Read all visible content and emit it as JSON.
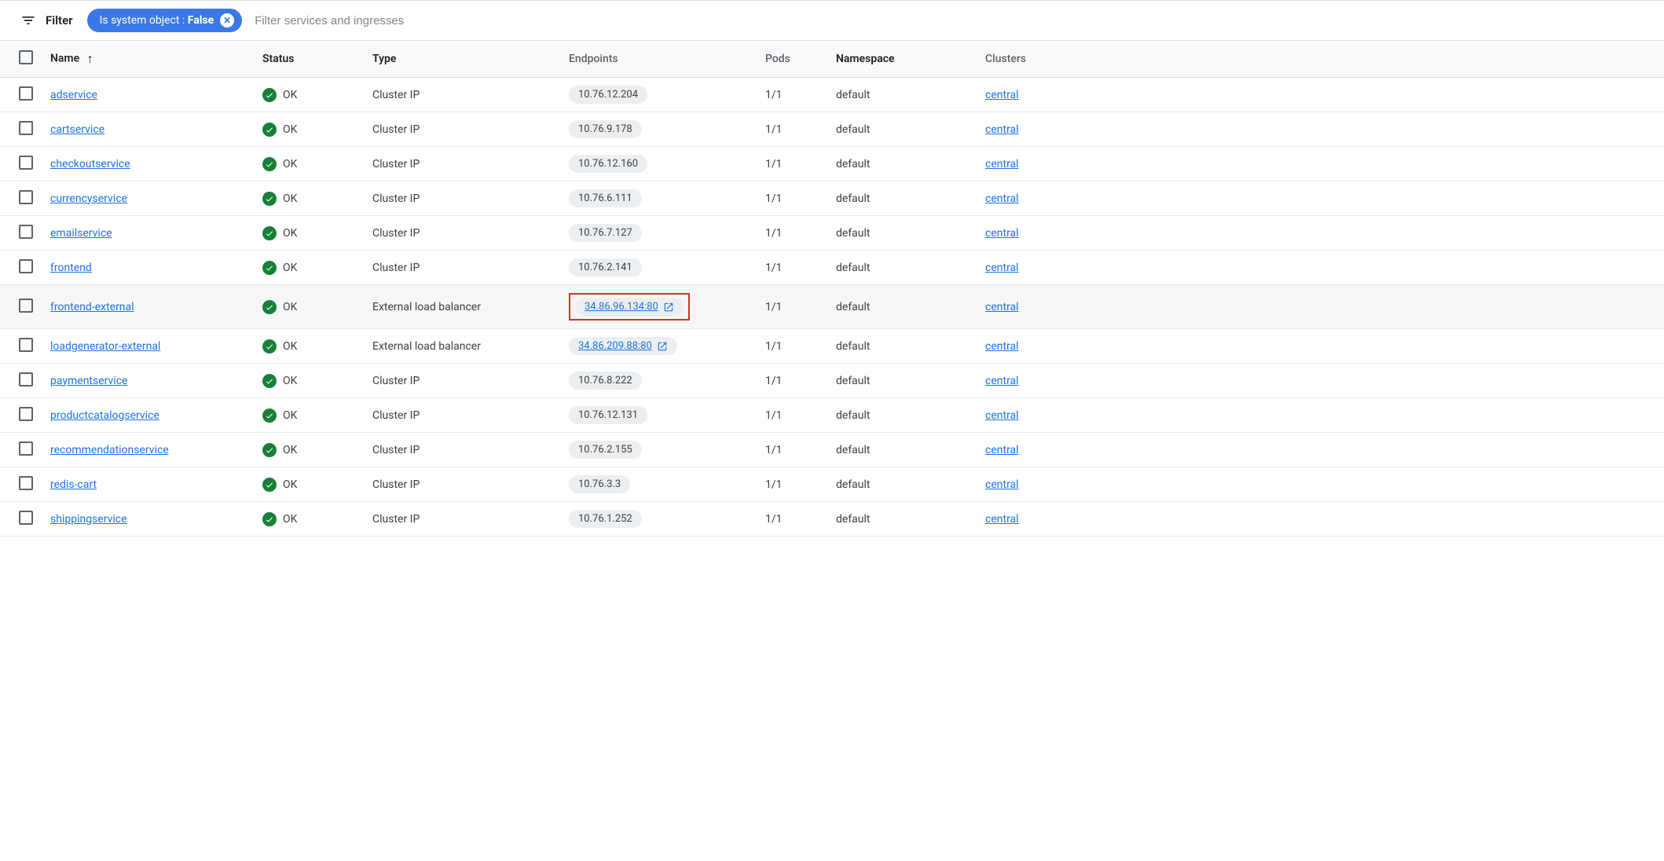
{
  "filter": {
    "label": "Filter",
    "chip_key": "Is system object",
    "chip_sep": " : ",
    "chip_value": "False",
    "placeholder": "Filter services and ingresses"
  },
  "columns": {
    "name": "Name",
    "status": "Status",
    "type": "Type",
    "endpoints": "Endpoints",
    "pods": "Pods",
    "namespace": "Namespace",
    "clusters": "Clusters"
  },
  "sort_indicator": "↑",
  "rows": [
    {
      "name": "adservice",
      "status": "OK",
      "type": "Cluster IP",
      "endpoint": "10.76.12.204",
      "endpoint_link": false,
      "pods": "1/1",
      "namespace": "default",
      "cluster": "central",
      "highlight": false
    },
    {
      "name": "cartservice",
      "status": "OK",
      "type": "Cluster IP",
      "endpoint": "10.76.9.178",
      "endpoint_link": false,
      "pods": "1/1",
      "namespace": "default",
      "cluster": "central",
      "highlight": false
    },
    {
      "name": "checkoutservice",
      "status": "OK",
      "type": "Cluster IP",
      "endpoint": "10.76.12.160",
      "endpoint_link": false,
      "pods": "1/1",
      "namespace": "default",
      "cluster": "central",
      "highlight": false
    },
    {
      "name": "currencyservice",
      "status": "OK",
      "type": "Cluster IP",
      "endpoint": "10.76.6.111",
      "endpoint_link": false,
      "pods": "1/1",
      "namespace": "default",
      "cluster": "central",
      "highlight": false
    },
    {
      "name": "emailservice",
      "status": "OK",
      "type": "Cluster IP",
      "endpoint": "10.76.7.127",
      "endpoint_link": false,
      "pods": "1/1",
      "namespace": "default",
      "cluster": "central",
      "highlight": false
    },
    {
      "name": "frontend",
      "status": "OK",
      "type": "Cluster IP",
      "endpoint": "10.76.2.141",
      "endpoint_link": false,
      "pods": "1/1",
      "namespace": "default",
      "cluster": "central",
      "highlight": false
    },
    {
      "name": "frontend-external",
      "status": "OK",
      "type": "External load balancer",
      "endpoint": "34.86.96.134:80",
      "endpoint_link": true,
      "pods": "1/1",
      "namespace": "default",
      "cluster": "central",
      "highlight": true
    },
    {
      "name": "loadgenerator-external",
      "status": "OK",
      "type": "External load balancer",
      "endpoint": "34.86.209.88:80",
      "endpoint_link": true,
      "pods": "1/1",
      "namespace": "default",
      "cluster": "central",
      "highlight": false
    },
    {
      "name": "paymentservice",
      "status": "OK",
      "type": "Cluster IP",
      "endpoint": "10.76.8.222",
      "endpoint_link": false,
      "pods": "1/1",
      "namespace": "default",
      "cluster": "central",
      "highlight": false
    },
    {
      "name": "productcatalogservice",
      "status": "OK",
      "type": "Cluster IP",
      "endpoint": "10.76.12.131",
      "endpoint_link": false,
      "pods": "1/1",
      "namespace": "default",
      "cluster": "central",
      "highlight": false
    },
    {
      "name": "recommendationservice",
      "status": "OK",
      "type": "Cluster IP",
      "endpoint": "10.76.2.155",
      "endpoint_link": false,
      "pods": "1/1",
      "namespace": "default",
      "cluster": "central",
      "highlight": false
    },
    {
      "name": "redis-cart",
      "status": "OK",
      "type": "Cluster IP",
      "endpoint": "10.76.3.3",
      "endpoint_link": false,
      "pods": "1/1",
      "namespace": "default",
      "cluster": "central",
      "highlight": false
    },
    {
      "name": "shippingservice",
      "status": "OK",
      "type": "Cluster IP",
      "endpoint": "10.76.1.252",
      "endpoint_link": false,
      "pods": "1/1",
      "namespace": "default",
      "cluster": "central",
      "highlight": false
    }
  ]
}
